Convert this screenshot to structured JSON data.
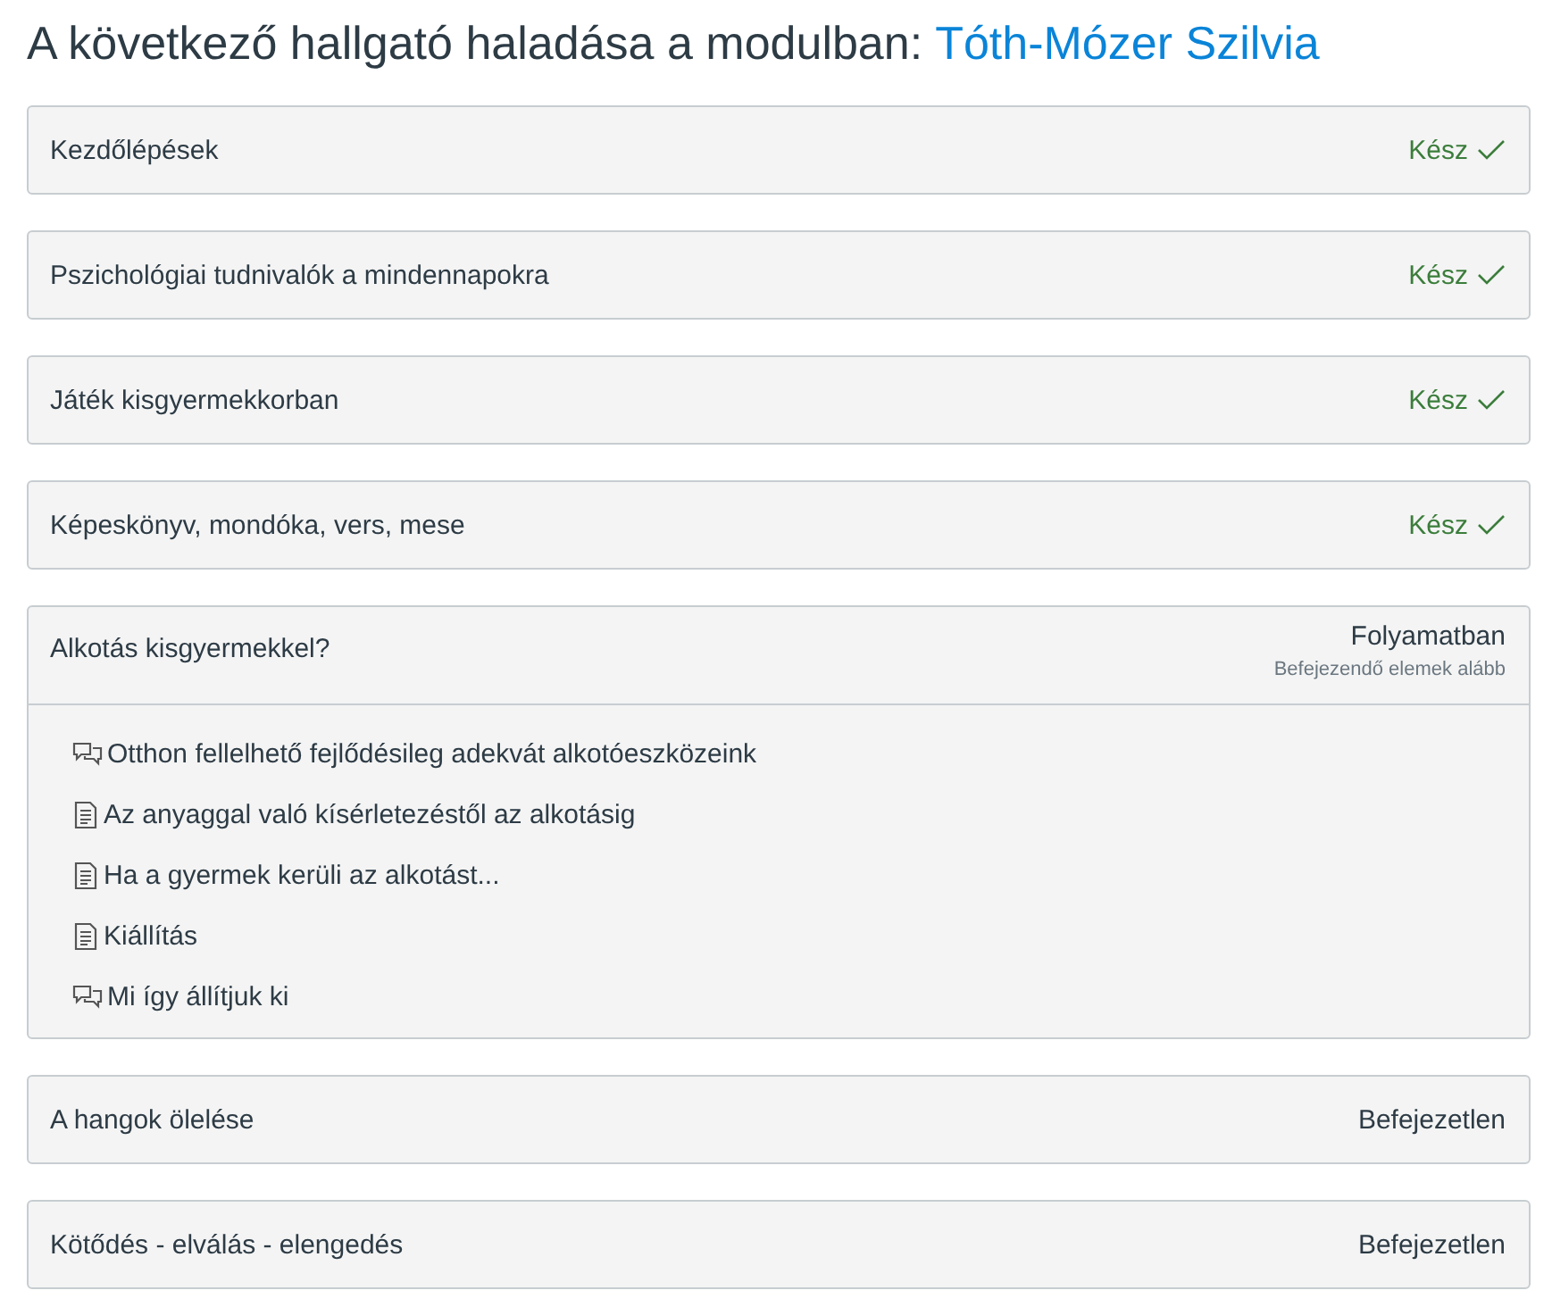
{
  "heading": {
    "text": "A következő hallgató haladása a modulban:",
    "student": "Tóth-Mózer Szilvia"
  },
  "modules": [
    {
      "title": "Kezdőlépések",
      "kind": "done",
      "status": "Kész"
    },
    {
      "title": "Pszichológiai tudnivalók a mindennapokra",
      "kind": "done",
      "status": "Kész"
    },
    {
      "title": "Játék kisgyermekkorban",
      "kind": "done",
      "status": "Kész"
    },
    {
      "title": "Képeskönyv, mondóka, vers, mese",
      "kind": "done",
      "status": "Kész"
    },
    {
      "title": "Alkotás kisgyermekkel?",
      "kind": "in_progress",
      "status": "Folyamatban",
      "note": "Befejezendő elemek alább",
      "items": [
        {
          "kind": "discussion",
          "title": "Otthon fellelhető fejlődésileg adekvát alkotóeszközeink"
        },
        {
          "kind": "page",
          "title": "Az anyaggal való kísérletezéstől az alkotásig"
        },
        {
          "kind": "page",
          "title": "Ha a gyermek kerüli az alkotást..."
        },
        {
          "kind": "page",
          "title": "Kiállítás"
        },
        {
          "kind": "discussion",
          "title": "Mi így állítjuk ki"
        }
      ]
    },
    {
      "title": "A hangok ölelése",
      "kind": "incomplete",
      "status": "Befejezetlen"
    },
    {
      "title": "Kötődés - elválás - elengedés",
      "kind": "incomplete",
      "status": "Befejezetlen"
    }
  ]
}
